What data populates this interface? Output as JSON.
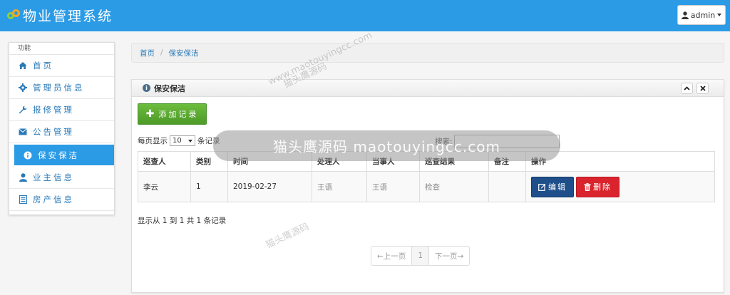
{
  "header": {
    "title": "物业管理系统",
    "user_label": "admin"
  },
  "sidebar": {
    "heading": "功能",
    "items": [
      {
        "label": "首页",
        "icon": "home-icon"
      },
      {
        "label": "管理员信息",
        "icon": "gear-icon"
      },
      {
        "label": "报修管理",
        "icon": "wrench-icon"
      },
      {
        "label": "公告管理",
        "icon": "envelope-icon"
      },
      {
        "label": "保安保洁",
        "icon": "info-icon"
      },
      {
        "label": "业主信息",
        "icon": "user-icon"
      },
      {
        "label": "房产信息",
        "icon": "list-icon"
      }
    ],
    "active_index": 4
  },
  "breadcrumb": {
    "home": "首页",
    "separator": "/",
    "current": "保安保洁"
  },
  "panel": {
    "title": "保安保洁",
    "add_button": "添加记录",
    "length_prefix": "每页显示",
    "length_value": "10",
    "length_suffix": "条记录",
    "search_label": "搜索:",
    "columns": [
      "巡查人",
      "类别",
      "时间",
      "处理人",
      "当事人",
      "巡查结果",
      "备注",
      "操作"
    ],
    "rows": [
      {
        "inspector": "李云",
        "category": "1",
        "time": "2019-02-27",
        "handler": "王语",
        "party": "王语",
        "result": "检查",
        "remark": ""
      }
    ],
    "edit_label": "编辑",
    "delete_label": "删除",
    "info": "显示从 1 到 1 共 1 条记录",
    "pager": {
      "prev": "←上一页",
      "page": "1",
      "next": "下一页→"
    }
  },
  "watermark": {
    "text": "猫头鹰源码 maotouyingcc.com",
    "small_cn": "猫头鹰源码",
    "small_en": "www.maotouyingcc.com"
  }
}
